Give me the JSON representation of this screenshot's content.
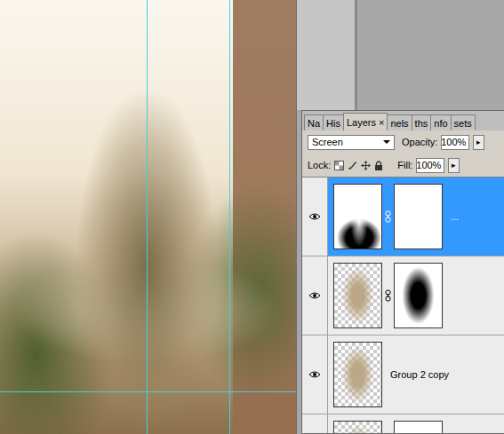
{
  "tabs": [
    {
      "label": "Na",
      "selected": false,
      "close": ""
    },
    {
      "label": "His",
      "selected": false,
      "close": ""
    },
    {
      "label": "Layers",
      "selected": true,
      "close": "×"
    },
    {
      "label": "nels",
      "selected": false,
      "close": ""
    },
    {
      "label": "ths",
      "selected": false,
      "close": ""
    },
    {
      "label": "nfo",
      "selected": false,
      "close": ""
    },
    {
      "label": "sets",
      "selected": false,
      "close": ""
    }
  ],
  "blend_mode": "Screen",
  "opacity": {
    "label": "Opacity:",
    "value": "100%",
    "arrow": "▸"
  },
  "lock": {
    "label": "Lock:"
  },
  "fill": {
    "label": "Fill:",
    "value": "100%",
    "arrow": "▸"
  },
  "layers": [
    {
      "name": "...",
      "visible": true,
      "selected": true,
      "kind": "silhouette",
      "mask": "white"
    },
    {
      "name": "",
      "visible": true,
      "selected": false,
      "kind": "blur",
      "mask": "radial"
    },
    {
      "name": "Group 2 copy",
      "visible": true,
      "selected": false,
      "kind": "blur",
      "mask": "none"
    },
    {
      "name": "",
      "visible": false,
      "selected": false,
      "kind": "blur",
      "mask": "white"
    }
  ]
}
